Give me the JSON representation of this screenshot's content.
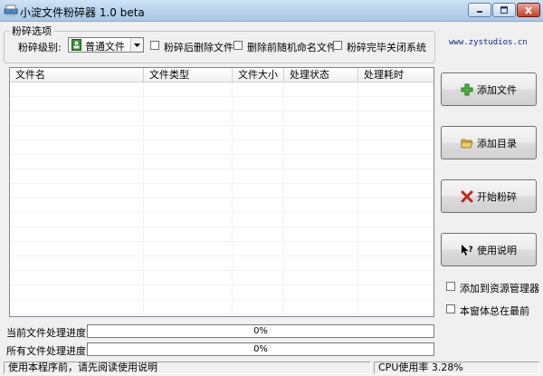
{
  "window": {
    "title": "小淀文件粉碎器 1.0 beta"
  },
  "options": {
    "group_title": "粉碎选项",
    "level_label": "粉碎级别:",
    "level_selected": "普通文件",
    "chk_delete_after": {
      "label": "粉碎后删除文件",
      "checked": false
    },
    "chk_rename_before": {
      "label": "删除前随机命名文件",
      "checked": false
    },
    "chk_shutdown": {
      "label": "粉碎完毕关闭系统",
      "checked": false
    },
    "website": "www.zystudios.cn"
  },
  "list": {
    "columns": [
      "文件名",
      "文件类型",
      "文件大小",
      "处理状态",
      "处理耗时"
    ],
    "rows": []
  },
  "buttons": {
    "add_file": "添加文件",
    "add_dir": "添加目录",
    "start": "开始粉碎",
    "help": "使用说明"
  },
  "side_options": {
    "chk_explorer": {
      "label": "添加到资源管理器",
      "checked": false
    },
    "chk_topmost": {
      "label": "本窗体总在最前",
      "checked": false
    }
  },
  "progress": {
    "current_label": "当前文件处理进度",
    "current_value": "0%",
    "current_fraction": 0,
    "all_label": "所有文件处理进度",
    "all_value": "0%",
    "all_fraction": 0
  },
  "status": {
    "hint": "使用本程序前，请先阅读使用说明",
    "cpu": "CPU使用率  3.28%"
  },
  "colors": {
    "accent_link": "#0a2890",
    "add_icon": "#3a9a2a",
    "close_icon": "#c0281c"
  }
}
